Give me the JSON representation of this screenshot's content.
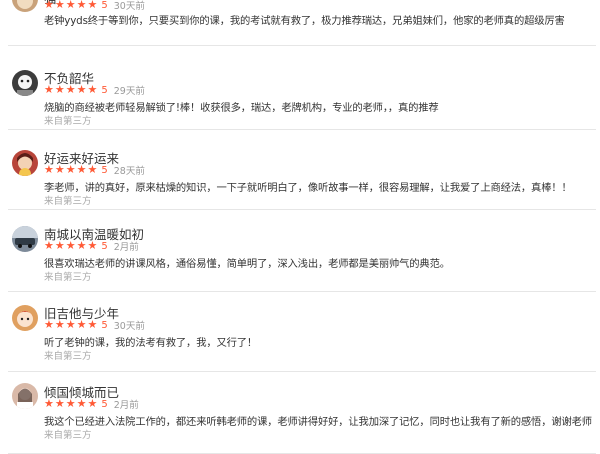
{
  "reviews": [
    {
      "name": "猫",
      "rating": 5,
      "score": "5",
      "time": "30天前",
      "content": "老钟yyds终于等到你，只要买到你的课，我的考试就有救了，极力推荐瑞达，兄弟姐妹们，他家的老师真的超级厉害",
      "source": "",
      "avatar_icon": "cat-avatar-icon",
      "avatar_color": "#c9a27a"
    },
    {
      "name": "不负韶华",
      "rating": 5,
      "score": "5",
      "time": "29天前",
      "content": "烧脑的商经被老师轻易解锁了!棒！收获很多，瑞达，老牌机构，专业的老师，，真的推荐",
      "source": "来自第三方",
      "avatar_icon": "cartoon-avatar-icon",
      "avatar_color": "#3c3c3c"
    },
    {
      "name": "好运来好运来",
      "rating": 5,
      "score": "5",
      "time": "28天前",
      "content": "李老师，讲的真好，原来枯燥的知识，一下子就听明白了，像听故事一样，很容易理解，让我爱了上商经法，真棒！！",
      "source": "来自第三方",
      "avatar_icon": "girl-avatar-icon",
      "avatar_color": "#b8453a"
    },
    {
      "name": "南城以南温暖如初",
      "rating": 5,
      "score": "5",
      "time": "2月前",
      "content": "很喜欢瑞达老师的讲课风格，通俗易懂，简单明了，深入浅出，老师都是美丽帅气的典范。",
      "source": "来自第三方",
      "avatar_icon": "car-avatar-icon",
      "avatar_color": "#7d8a99"
    },
    {
      "name": "旧吉他与少年",
      "rating": 5,
      "score": "5",
      "time": "30天前",
      "content": "听了老钟的课，我的法考有救了，我，又行了！",
      "source": "来自第三方",
      "avatar_icon": "anime-avatar-icon",
      "avatar_color": "#e0a060"
    },
    {
      "name": "倾国倾城而已",
      "rating": 5,
      "score": "5",
      "time": "2月前",
      "content": "我这个已经进入法院工作的，都还来听韩老师的课，老师讲得好好，让我加深了记忆，同时也让我有了新的感悟，谢谢老师",
      "source": "来自第三方",
      "avatar_icon": "photo-avatar-icon",
      "avatar_color": "#d9b9a8"
    }
  ]
}
